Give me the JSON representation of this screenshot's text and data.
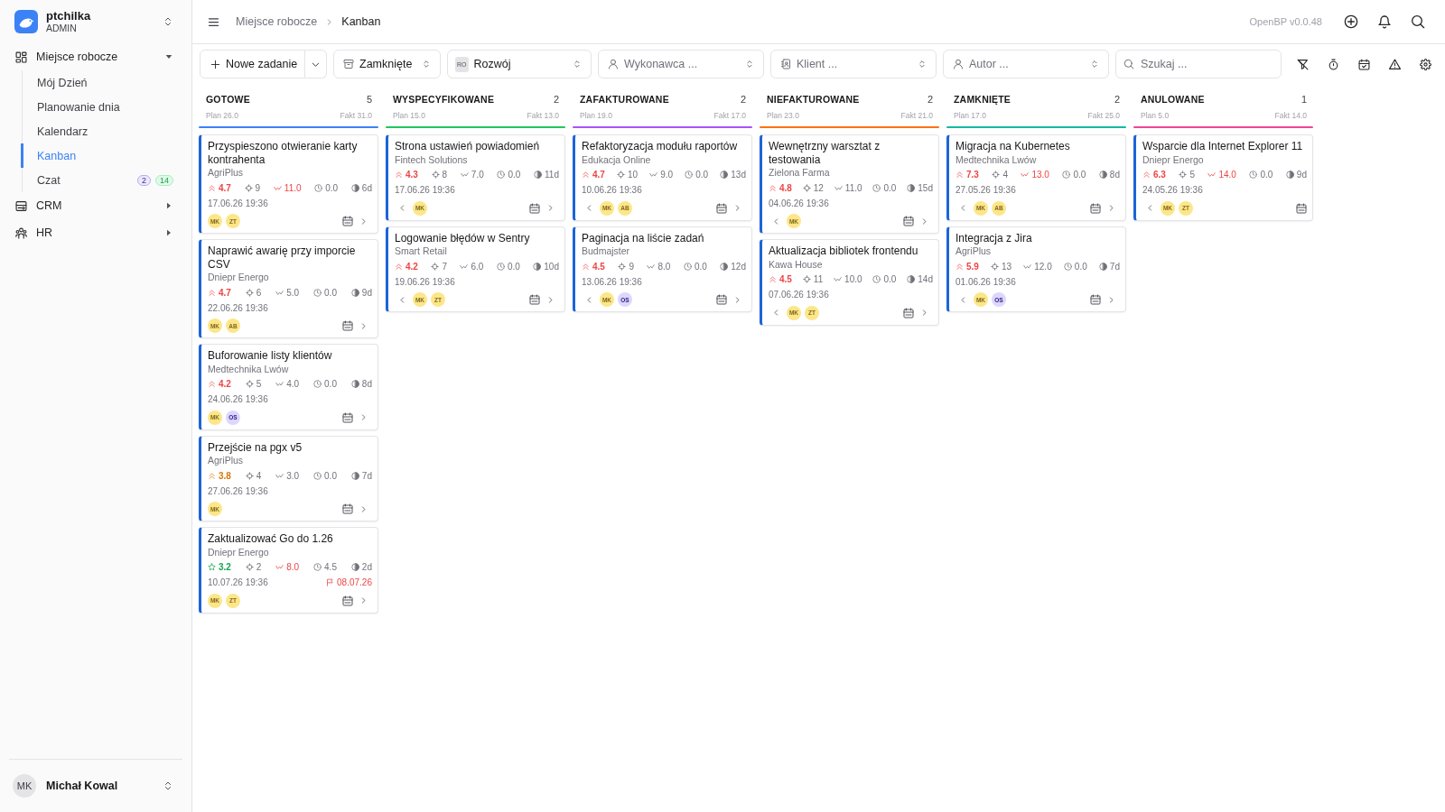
{
  "sidebar": {
    "workspace": {
      "name": "ptchilka",
      "role": "ADMIN"
    },
    "nav": [
      {
        "kind": "workspace",
        "label": "Miejsce robocze",
        "expanded": true,
        "children": [
          {
            "label": "Mój Dzień",
            "selected": false
          },
          {
            "label": "Planowanie dnia",
            "selected": false
          },
          {
            "label": "Kalendarz",
            "selected": false
          },
          {
            "label": "Kanban",
            "selected": true
          },
          {
            "label": "Czat",
            "selected": false,
            "badges": [
              {
                "text": "2",
                "color": "#ede9fe"
              },
              {
                "text": "14",
                "color": "#dcfce7"
              }
            ]
          }
        ]
      },
      {
        "kind": "crm",
        "label": "CRM",
        "expanded": false
      },
      {
        "kind": "hr",
        "label": "HR",
        "expanded": false
      }
    ],
    "user": {
      "initials": "MK",
      "name": "Michał Kowal"
    }
  },
  "header": {
    "breadcrumbs": [
      "Miejsce robocze",
      "Kanban"
    ],
    "version": "OpenBP v0.0.48"
  },
  "toolbar": {
    "new_task": "Nowe zadanie",
    "filters": [
      {
        "kind": "archive",
        "value": "Zamknięte"
      },
      {
        "kind": "team",
        "badge": "RO",
        "value": "Rozwój"
      },
      {
        "kind": "person",
        "placeholder": "Wykonawca ..."
      },
      {
        "kind": "client",
        "placeholder": "Klient ..."
      },
      {
        "kind": "person",
        "placeholder": "Autor ..."
      }
    ],
    "search": {
      "placeholder": "Szukaj ..."
    }
  },
  "board": {
    "columns": [
      {
        "title": "GOTOWE",
        "count": "5",
        "plan": "Plan 26.0",
        "fact": "Fakt 31.0",
        "color": "#3b82f6",
        "cards": [
          {
            "title": "Przyspieszono otwieranie karty kontrahenta",
            "client": "AgriPlus",
            "priority": {
              "text": "4.7",
              "kind": "chevrons",
              "color": "#ef4444"
            },
            "count": "9",
            "estimate": "11.0",
            "over_estimate": true,
            "time": "0.0",
            "age": "6d",
            "date": "17.06.26 19:36",
            "assignees": [
              {
                "initials": "MK",
                "color": "#fde68a"
              },
              {
                "initials": "ZT",
                "color": "#fde68a"
              }
            ],
            "move_left": false,
            "move_right": true
          },
          {
            "title": "Naprawić awarię przy imporcie CSV",
            "client": "Dniepr Energo",
            "priority": {
              "text": "4.7",
              "kind": "chevrons",
              "color": "#ef4444"
            },
            "count": "6",
            "estimate": "5.0",
            "over_estimate": false,
            "time": "0.0",
            "age": "9d",
            "date": "22.06.26 19:36",
            "assignees": [
              {
                "initials": "MK",
                "color": "#fde68a"
              },
              {
                "initials": "AB",
                "color": "#fde68a"
              }
            ],
            "move_left": false,
            "move_right": true
          },
          {
            "title": "Buforowanie listy klientów",
            "client": "Medtechnika Lwów",
            "priority": {
              "text": "4.2",
              "kind": "chevrons",
              "color": "#ef4444"
            },
            "count": "5",
            "estimate": "4.0",
            "over_estimate": false,
            "time": "0.0",
            "age": "8d",
            "date": "24.06.26 19:36",
            "assignees": [
              {
                "initials": "MK",
                "color": "#fde68a"
              },
              {
                "initials": "OS",
                "color": "#ddd6fe"
              }
            ],
            "move_left": false,
            "move_right": true
          },
          {
            "title": "Przejście na pgx v5",
            "client": "AgriPlus",
            "priority": {
              "text": "3.8",
              "kind": "chevrons",
              "color": "#d97706"
            },
            "count": "4",
            "estimate": "3.0",
            "over_estimate": false,
            "time": "0.0",
            "age": "7d",
            "date": "27.06.26 19:36",
            "assignees": [
              {
                "initials": "MK",
                "color": "#fde68a"
              }
            ],
            "move_left": false,
            "move_right": true
          },
          {
            "title": "Zaktualizować Go do 1.26",
            "client": "Dniepr Energo",
            "priority": {
              "text": "3.2",
              "kind": "star",
              "color": "#16a34a"
            },
            "count": "2",
            "estimate": "8.0",
            "over_estimate": true,
            "time": "4.5",
            "age": "2d",
            "date": "10.07.26 19:36",
            "deadline": "08.07.26",
            "assignees": [
              {
                "initials": "MK",
                "color": "#fde68a"
              },
              {
                "initials": "ZT",
                "color": "#fde68a"
              }
            ],
            "move_left": false,
            "move_right": true
          }
        ]
      },
      {
        "title": "WYSPECYFIKOWANE",
        "count": "2",
        "plan": "Plan 15.0",
        "fact": "Fakt 13.0",
        "color": "#22c55e",
        "cards": [
          {
            "title": "Strona ustawień powiadomień",
            "client": "Fintech Solutions",
            "priority": {
              "text": "4.3",
              "kind": "chevrons",
              "color": "#ef4444"
            },
            "count": "8",
            "estimate": "7.0",
            "over_estimate": false,
            "time": "0.0",
            "age": "11d",
            "date": "17.06.26 19:36",
            "assignees": [
              {
                "initials": "MK",
                "color": "#fde68a"
              }
            ],
            "move_left": true,
            "move_right": true
          },
          {
            "title": "Logowanie błędów w Sentry",
            "client": "Smart Retail",
            "priority": {
              "text": "4.2",
              "kind": "chevrons",
              "color": "#ef4444"
            },
            "count": "7",
            "estimate": "6.0",
            "over_estimate": false,
            "time": "0.0",
            "age": "10d",
            "date": "19.06.26 19:36",
            "assignees": [
              {
                "initials": "MK",
                "color": "#fde68a"
              },
              {
                "initials": "ZT",
                "color": "#fde68a"
              }
            ],
            "move_left": true,
            "move_right": true
          }
        ]
      },
      {
        "title": "ZAFAKTUROWANE",
        "count": "2",
        "plan": "Plan 19.0",
        "fact": "Fakt 17.0",
        "color": "#a855f7",
        "cards": [
          {
            "title": "Refaktoryzacja modułu raportów",
            "client": "Edukacja Online",
            "priority": {
              "text": "4.7",
              "kind": "chevrons",
              "color": "#ef4444"
            },
            "count": "10",
            "estimate": "9.0",
            "over_estimate": false,
            "time": "0.0",
            "age": "13d",
            "date": "10.06.26 19:36",
            "assignees": [
              {
                "initials": "MK",
                "color": "#fde68a"
              },
              {
                "initials": "AB",
                "color": "#fde68a"
              }
            ],
            "move_left": true,
            "move_right": true
          },
          {
            "title": "Paginacja na liście zadań",
            "client": "Budmajster",
            "priority": {
              "text": "4.5",
              "kind": "chevrons",
              "color": "#ef4444"
            },
            "count": "9",
            "estimate": "8.0",
            "over_estimate": false,
            "time": "0.0",
            "age": "12d",
            "date": "13.06.26 19:36",
            "assignees": [
              {
                "initials": "MK",
                "color": "#fde68a"
              },
              {
                "initials": "OS",
                "color": "#ddd6fe"
              }
            ],
            "move_left": true,
            "move_right": true
          }
        ]
      },
      {
        "title": "NIEFAKTUROWANE",
        "count": "2",
        "plan": "Plan 23.0",
        "fact": "Fakt 21.0",
        "color": "#f97316",
        "cards": [
          {
            "title": "Wewnętrzny warsztat z testowania",
            "client": "Zielona Farma",
            "priority": {
              "text": "4.8",
              "kind": "chevrons",
              "color": "#ef4444"
            },
            "count": "12",
            "estimate": "11.0",
            "over_estimate": false,
            "time": "0.0",
            "age": "15d",
            "date": "04.06.26 19:36",
            "assignees": [
              {
                "initials": "MK",
                "color": "#fde68a"
              }
            ],
            "move_left": true,
            "move_right": true
          },
          {
            "title": "Aktualizacja bibliotek frontendu",
            "client": "Kawa House",
            "priority": {
              "text": "4.5",
              "kind": "chevrons",
              "color": "#ef4444"
            },
            "count": "11",
            "estimate": "10.0",
            "over_estimate": false,
            "time": "0.0",
            "age": "14d",
            "date": "07.06.26 19:36",
            "assignees": [
              {
                "initials": "MK",
                "color": "#fde68a"
              },
              {
                "initials": "ZT",
                "color": "#fde68a"
              }
            ],
            "move_left": true,
            "move_right": true
          }
        ]
      },
      {
        "title": "ZAMKNIĘTE",
        "count": "2",
        "plan": "Plan 17.0",
        "fact": "Fakt 25.0",
        "color": "#14b8a6",
        "cards": [
          {
            "title": "Migracja na Kubernetes",
            "client": "Medtechnika Lwów",
            "priority": {
              "text": "7.3",
              "kind": "chevrons",
              "color": "#ef4444"
            },
            "count": "4",
            "estimate": "13.0",
            "over_estimate": true,
            "time": "0.0",
            "age": "8d",
            "date": "27.05.26 19:36",
            "assignees": [
              {
                "initials": "MK",
                "color": "#fde68a"
              },
              {
                "initials": "AB",
                "color": "#fde68a"
              }
            ],
            "move_left": true,
            "move_right": true
          },
          {
            "title": "Integracja z Jira",
            "client": "AgriPlus",
            "priority": {
              "text": "5.9",
              "kind": "chevrons",
              "color": "#ef4444"
            },
            "count": "13",
            "estimate": "12.0",
            "over_estimate": false,
            "time": "0.0",
            "age": "7d",
            "date": "01.06.26 19:36",
            "assignees": [
              {
                "initials": "MK",
                "color": "#fde68a"
              },
              {
                "initials": "OS",
                "color": "#ddd6fe"
              }
            ],
            "move_left": true,
            "move_right": true
          }
        ]
      },
      {
        "title": "ANULOWANE",
        "count": "1",
        "plan": "Plan 5.0",
        "fact": "Fakt 14.0",
        "color": "#ec4899",
        "cards": [
          {
            "title": "Wsparcie dla Internet Explorer 11",
            "client": "Dniepr Energo",
            "priority": {
              "text": "6.3",
              "kind": "chevrons",
              "color": "#ef4444"
            },
            "count": "5",
            "estimate": "14.0",
            "over_estimate": true,
            "time": "0.0",
            "age": "9d",
            "date": "24.05.26 19:36",
            "assignees": [
              {
                "initials": "MK",
                "color": "#fde68a"
              },
              {
                "initials": "ZT",
                "color": "#fde68a"
              }
            ],
            "move_left": true,
            "move_right": false
          }
        ]
      }
    ]
  }
}
